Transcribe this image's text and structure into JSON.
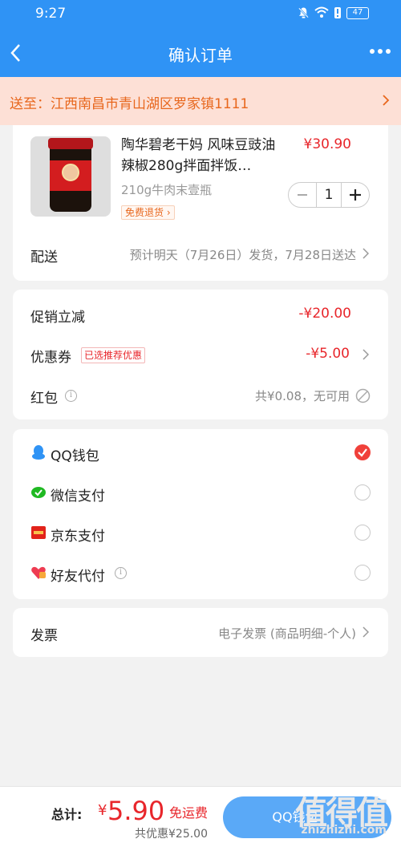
{
  "status_bar": {
    "time": "9:27",
    "battery": "47"
  },
  "nav": {
    "title": "确认订单"
  },
  "address": {
    "text": "送至：江西南昌市青山湖区罗家镇1111"
  },
  "product": {
    "title": "陶华碧老干妈 风味豆豉油辣椒280g拌面拌饭…",
    "price": "¥30.90",
    "spec": "210g牛肉末壹瓶",
    "badge": "免费退货",
    "quantity": "1"
  },
  "delivery": {
    "label": "配送",
    "value": "预计明天（7月26日）发货，7月28日送达"
  },
  "discounts": {
    "promo_label": "促销立减",
    "promo_value": "-¥20.00",
    "coupon_label": "优惠券",
    "coupon_tag": "已选推荐优惠",
    "coupon_value": "-¥5.00",
    "redpacket_label": "红包",
    "redpacket_value": "共¥0.08，无可用"
  },
  "payment": {
    "methods": [
      {
        "label": "QQ钱包",
        "icon": "qq-penguin-icon",
        "selected": true
      },
      {
        "label": "微信支付",
        "icon": "wechat-icon",
        "selected": false
      },
      {
        "label": "京东支付",
        "icon": "jd-pay-icon",
        "selected": false
      },
      {
        "label": "好友代付",
        "icon": "friend-pay-icon",
        "selected": false
      }
    ]
  },
  "invoice": {
    "label": "发票",
    "value": "电子发票 (商品明细-个人)"
  },
  "bottom": {
    "total_label": "总计:",
    "currency": "¥",
    "amount": "5.90",
    "free_shipping": "免运费",
    "saving": "共优惠¥25.00",
    "pay_button": "QQ钱包"
  },
  "watermark": {
    "chars": "值得值",
    "url": "zhizhizhi.com"
  },
  "colors": {
    "primary": "#2f93f5",
    "price_red": "#e8262b",
    "address_orange": "#e8671d",
    "address_bg": "#fde0d6"
  }
}
